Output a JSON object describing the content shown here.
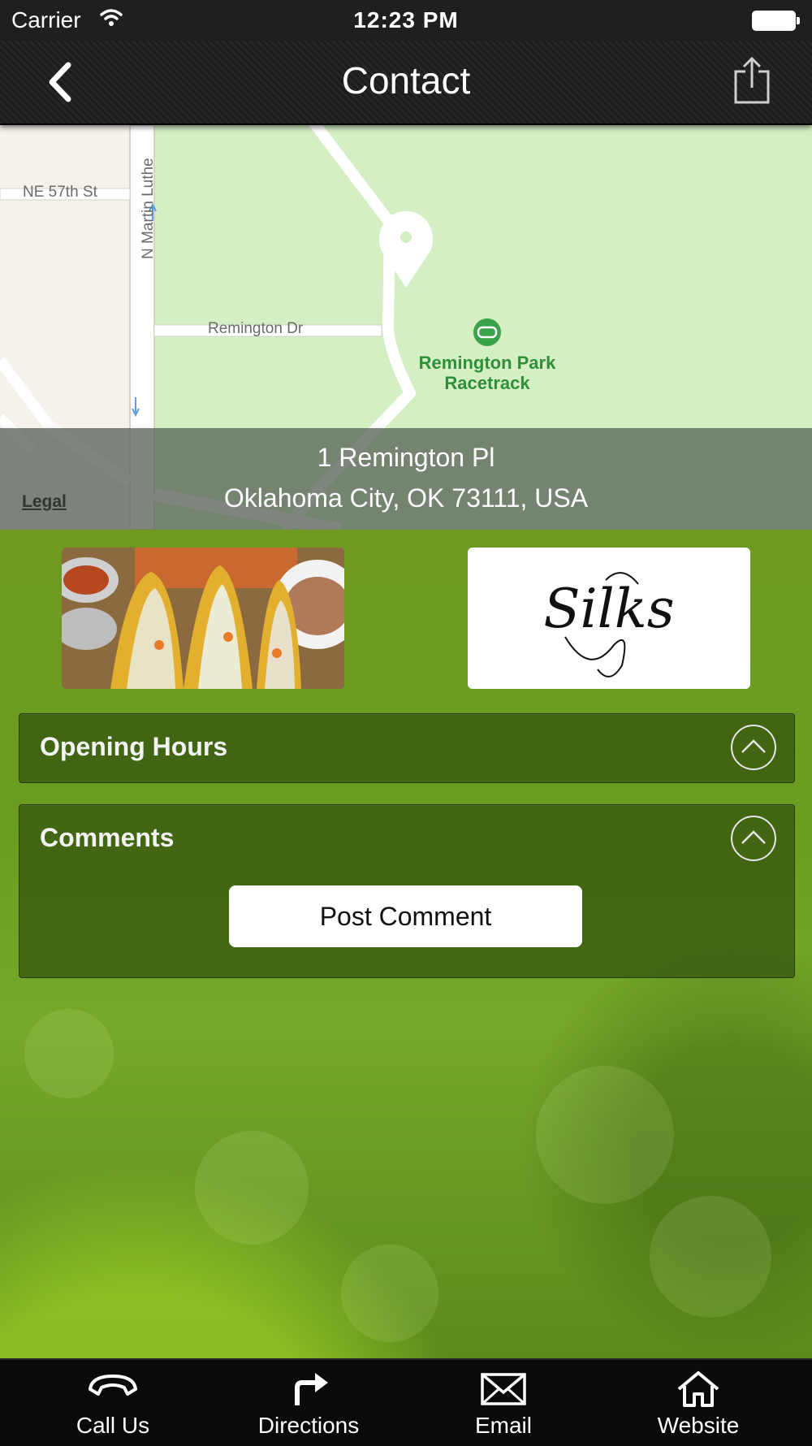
{
  "status_bar": {
    "carrier": "Carrier",
    "time": "12:23 PM",
    "icons": [
      "wifi-icon",
      "battery-icon"
    ]
  },
  "nav_bar": {
    "title": "Contact",
    "back_icon": "chevron-left-icon",
    "share_icon": "share-icon"
  },
  "map": {
    "streets": [
      "NE 57th St",
      "N Martin Luthe",
      "Remington Dr"
    ],
    "poi": {
      "name_line1": "Remington Park",
      "name_line2": "Racetrack",
      "icon": "stadium-icon"
    },
    "pin_icon": "map-pin-icon",
    "legal": "Legal",
    "address_line1": "1 Remington Pl",
    "address_line2": "Oklahoma City, OK 73111, USA"
  },
  "gallery": [
    {
      "name": "tacos photo"
    },
    {
      "name": "logo",
      "logo_text": "Silks"
    }
  ],
  "sections": {
    "opening_hours": {
      "title": "Opening Hours",
      "icon": "chevron-up-circle-icon"
    },
    "comments": {
      "title": "Comments",
      "icon": "chevron-up-circle-icon",
      "button": "Post Comment"
    }
  },
  "tab_bar": [
    {
      "label": "Call Us",
      "icon": "phone-icon"
    },
    {
      "label": "Directions",
      "icon": "directions-arrow-icon"
    },
    {
      "label": "Email",
      "icon": "envelope-icon"
    },
    {
      "label": "Website",
      "icon": "home-icon"
    }
  ],
  "colors": {
    "nav_bg": "#1f1f1f",
    "park_green": "#d4efc3",
    "poi_green": "#2f8f3a",
    "content_green": "#6a9d1f",
    "panel_bg": "#32500f"
  }
}
